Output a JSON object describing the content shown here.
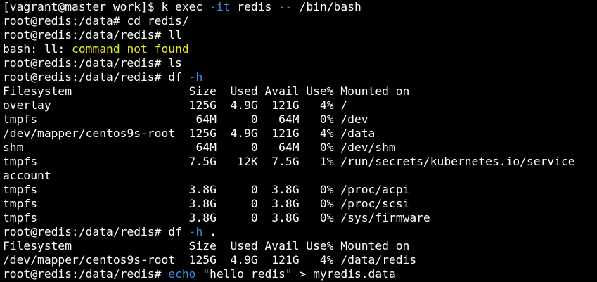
{
  "colors": {
    "background": "#000000",
    "foreground": "#ffffff",
    "flag": "#3a8ee8",
    "error": "#e8e82a"
  },
  "lines": [
    {
      "name": "cmd-kubectl-exec",
      "segments": [
        {
          "text": "[vagrant@master work]$ k exec "
        },
        {
          "text": "-it",
          "color": "blue"
        },
        {
          "text": " redis "
        },
        {
          "text": "--",
          "color": "blue"
        },
        {
          "text": " /bin/bash"
        }
      ]
    },
    {
      "name": "cmd-cd-redis",
      "segments": [
        {
          "text": "root@redis:/data# cd redis/"
        }
      ]
    },
    {
      "name": "cmd-ll",
      "segments": [
        {
          "text": "root@redis:/data/redis# ll"
        }
      ]
    },
    {
      "name": "output-ll-error",
      "segments": [
        {
          "text": "bash: ll: "
        },
        {
          "text": "command not found",
          "color": "yellow"
        }
      ]
    },
    {
      "name": "cmd-ls",
      "segments": [
        {
          "text": "root@redis:/data/redis# ls"
        }
      ]
    },
    {
      "name": "cmd-df-h",
      "segments": [
        {
          "text": "root@redis:/data/redis# df "
        },
        {
          "text": "-h",
          "color": "blue"
        }
      ]
    },
    {
      "name": "df-header",
      "segments": [
        {
          "text": "Filesystem                 Size  Used Avail Use% Mounted on"
        }
      ]
    },
    {
      "name": "df-row-overlay",
      "segments": [
        {
          "text": "overlay                    125G  4.9G  121G   4% /"
        }
      ]
    },
    {
      "name": "df-row-tmpfs-dev",
      "segments": [
        {
          "text": "tmpfs                       64M     0   64M   0% /dev"
        }
      ]
    },
    {
      "name": "df-row-centos-root",
      "segments": [
        {
          "text": "/dev/mapper/centos9s-root  125G  4.9G  121G   4% /data"
        }
      ]
    },
    {
      "name": "df-row-shm",
      "segments": [
        {
          "text": "shm                         64M     0   64M   0% /dev/shm"
        }
      ]
    },
    {
      "name": "df-row-tmpfs-secrets",
      "segments": [
        {
          "text": "tmpfs                      7.5G   12K  7.5G   1% /run/secrets/kubernetes.io/service"
        }
      ]
    },
    {
      "name": "df-row-tmpfs-secrets-wrap",
      "segments": [
        {
          "text": "account"
        }
      ]
    },
    {
      "name": "df-row-tmpfs-acpi",
      "segments": [
        {
          "text": "tmpfs                      3.8G     0  3.8G   0% /proc/acpi"
        }
      ]
    },
    {
      "name": "df-row-tmpfs-scsi",
      "segments": [
        {
          "text": "tmpfs                      3.8G     0  3.8G   0% /proc/scsi"
        }
      ]
    },
    {
      "name": "df-row-tmpfs-firmware",
      "segments": [
        {
          "text": "tmpfs                      3.8G     0  3.8G   0% /sys/firmware"
        }
      ]
    },
    {
      "name": "cmd-df-h-dot",
      "segments": [
        {
          "text": "root@redis:/data/redis# df "
        },
        {
          "text": "-h",
          "color": "blue"
        },
        {
          "text": " ."
        }
      ]
    },
    {
      "name": "df2-header",
      "segments": [
        {
          "text": "Filesystem                 Size  Used Avail Use% Mounted on"
        }
      ]
    },
    {
      "name": "df2-row-centos-root",
      "segments": [
        {
          "text": "/dev/mapper/centos9s-root  125G  4.9G  121G   4% /data/redis"
        }
      ]
    },
    {
      "name": "cmd-echo",
      "segments": [
        {
          "text": "root@redis:/data/redis# "
        },
        {
          "text": "echo",
          "color": "blue"
        },
        {
          "text": " \"hello redis\" > myredis.data"
        }
      ]
    }
  ]
}
